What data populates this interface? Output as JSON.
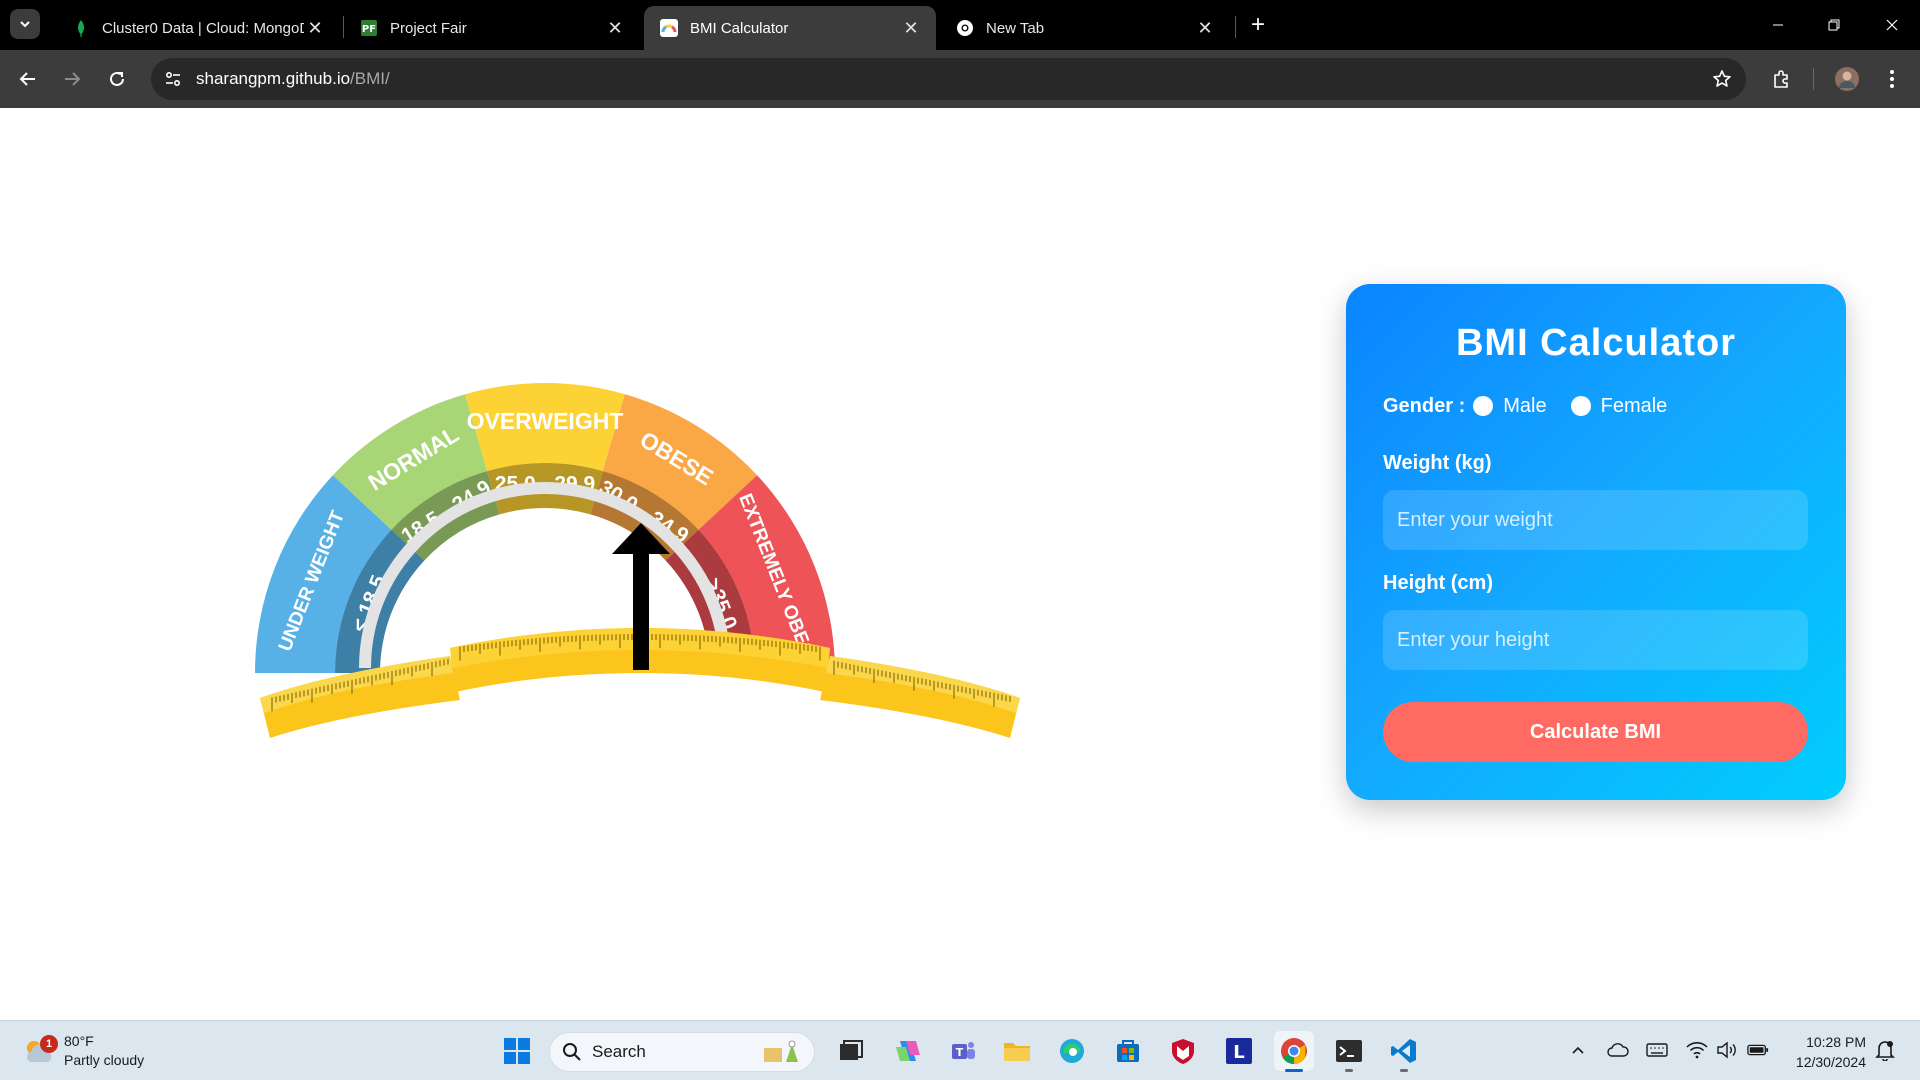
{
  "browser": {
    "tabs": [
      {
        "title": "Cluster0 Data | Cloud: MongoDB",
        "favicon": "mongodb-leaf-icon",
        "active": false
      },
      {
        "title": "Project Fair",
        "favicon": "project-fair-icon",
        "active": false
      },
      {
        "title": "BMI Calculator",
        "favicon": "bmi-gauge-icon",
        "active": true
      },
      {
        "title": "New Tab",
        "favicon": "chrome-icon",
        "active": false
      }
    ],
    "url": {
      "host": "sharangpm.github.io",
      "path": "/BMI/"
    }
  },
  "gauge": {
    "segments": [
      {
        "label": "UNDER WEIGHT",
        "range": "< 18.5",
        "color": "#57b1e6"
      },
      {
        "label": "NORMAL",
        "range": "18.5 - 24.9",
        "color": "#a8d676"
      },
      {
        "label": "OVERWEIGHT",
        "range": "25.0 - 29.9",
        "color": "#fdd235"
      },
      {
        "label": "OBESE",
        "range": "30.0 - 34.9",
        "color": "#faa746"
      },
      {
        "label": "EXTREMELY OBESE",
        "range": ">35.0",
        "color": "#ee5357"
      }
    ],
    "tape_color": "#fcc51c",
    "needle_color": "#000000"
  },
  "calculator": {
    "title": "BMI Calculator",
    "gender_label": "Gender :",
    "gender_options": [
      "Male",
      "Female"
    ],
    "weight_label": "Weight (kg)",
    "weight_placeholder": "Enter your weight",
    "weight_value": "",
    "height_label": "Height (cm)",
    "height_placeholder": "Enter your height",
    "height_value": "",
    "button_label": "Calculate BMI",
    "button_color": "#ff6b62"
  },
  "taskbar": {
    "weather": {
      "temp": "80°F",
      "condition": "Partly cloudy",
      "badge": "1"
    },
    "search_label": "Search",
    "clock": {
      "time": "10:28 PM",
      "date": "12/30/2024"
    }
  }
}
